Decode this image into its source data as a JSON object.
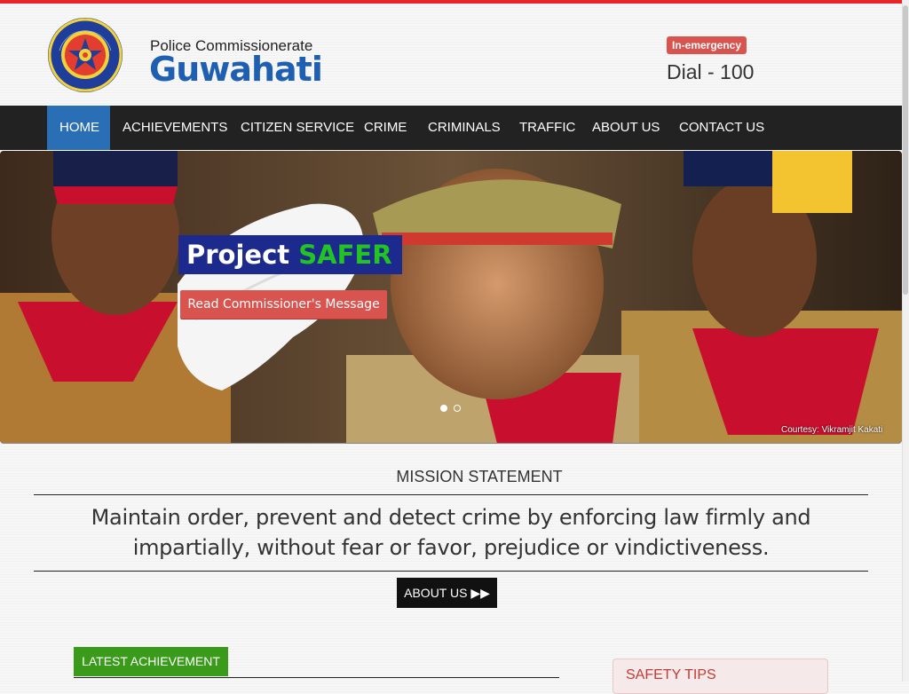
{
  "header": {
    "brand_small": "Police Commissionerate",
    "brand_big": "Guwahati",
    "emergency_badge": "In-emergency",
    "dial": "Dial - 100",
    "logo_text_top": "ASSAM POLICE",
    "logo_text_bottom": "জনসেৱাৰ্থে"
  },
  "nav": {
    "items": [
      "HOME",
      "ACHIEVEMENTS",
      "CITIZEN SERVICE",
      "CRIME",
      "CRIMINALS",
      "TRAFFIC",
      "ABOUT US",
      "CONTACT US"
    ],
    "active": "HOME"
  },
  "hero": {
    "title_part1": "Project",
    "title_part2": "SAFER",
    "button_label": "Read Commissioner's Message",
    "courtesy": "Courtesy: Vikramjit Kakati",
    "prev_icon": "chevron-left-icon",
    "next_icon": "chevron-right-icon",
    "slides": 2,
    "active_slide": 1
  },
  "mission": {
    "heading": "MISSION STATEMENT",
    "text": "Maintain order, prevent and detect crime by enforcing law firmly and impartially, without fear or favor, prejudice or vindictiveness.",
    "about_button": "ABOUT US"
  },
  "latest": {
    "button_label": "LATEST ACHIEVEMENT"
  },
  "safety": {
    "title": "SAFETY TIPS"
  },
  "colors": {
    "top_bar": "#e8262a",
    "brand_blue": "#1f5fb2",
    "nav_bg": "#222222",
    "nav_active": "#2a6fb6",
    "danger": "#d9534f",
    "hero_title_bg": "#1b2a8c",
    "safer_green": "#22c322",
    "latest_green": "#3a9a1a"
  }
}
